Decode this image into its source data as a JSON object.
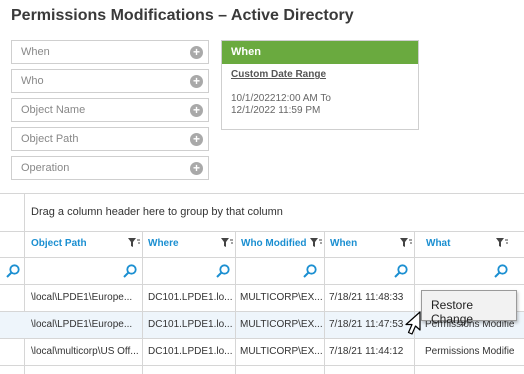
{
  "page": {
    "title": "Permissions Modifications – Active Directory"
  },
  "filters": [
    {
      "label": "When"
    },
    {
      "label": "Who"
    },
    {
      "label": "Object Name"
    },
    {
      "label": "Object Path"
    },
    {
      "label": "Operation"
    }
  ],
  "when_panel": {
    "header": "When",
    "range_label": "Custom Date Range",
    "line1": "10/1/202212:00 AM To",
    "line2": "12/1/2022 11:59 PM"
  },
  "grid": {
    "group_hint": "Drag a column header here to group by that column",
    "columns": [
      {
        "label": "Object Path"
      },
      {
        "label": "Where"
      },
      {
        "label": "Who Modified"
      },
      {
        "label": "When"
      },
      {
        "label": "What"
      }
    ],
    "rows": [
      {
        "object_path": "\\local\\LPDE1\\Europe...",
        "where": "DC101.LPDE1.lo...",
        "who_modified": "MULTICORP\\EX...",
        "when": "7/18/21   11:48:33",
        "what": ""
      },
      {
        "object_path": "\\local\\LPDE1\\Europe...",
        "where": "DC101.LPDE1.lo...",
        "who_modified": "MULTICORP\\EX...",
        "when": "7/18/21   11:47:53",
        "what": "Permissions Modifie"
      },
      {
        "object_path": "\\local\\multicorp\\US Off...",
        "where": "DC101.LPDE1.lo...",
        "who_modified": "MULTICORP\\EX...",
        "when": "7/18/21   11:44:12",
        "what": "Permissions Modifie"
      }
    ]
  },
  "context_menu": {
    "restore_label": "Restore Change"
  },
  "colors": {
    "accent": "#1b8fd1",
    "when_header": "#6aaa3f",
    "row_highlight": "#eef5fb"
  }
}
